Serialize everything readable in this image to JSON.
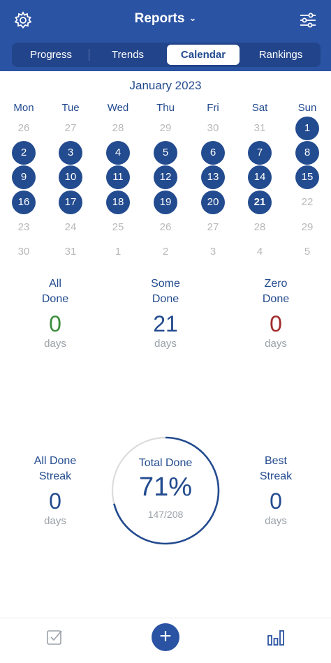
{
  "header": {
    "title": "Reports",
    "title_chevron": "⌄",
    "left_icon": "gear-icon",
    "right_icon": "sliders-icon"
  },
  "tabs": [
    {
      "label": "Progress",
      "active": false
    },
    {
      "label": "Trends",
      "active": false
    },
    {
      "label": "Calendar",
      "active": true
    },
    {
      "label": "Rankings",
      "active": false
    }
  ],
  "calendar": {
    "month_label": "January 2023",
    "weekdays": [
      "Mon",
      "Tue",
      "Wed",
      "Thu",
      "Fri",
      "Sat",
      "Sun"
    ],
    "weeks": [
      [
        {
          "d": "26",
          "s": "faded"
        },
        {
          "d": "27",
          "s": "faded"
        },
        {
          "d": "28",
          "s": "faded"
        },
        {
          "d": "29",
          "s": "faded"
        },
        {
          "d": "30",
          "s": "faded"
        },
        {
          "d": "31",
          "s": "faded"
        },
        {
          "d": "1",
          "s": "done"
        }
      ],
      [
        {
          "d": "2",
          "s": "done"
        },
        {
          "d": "3",
          "s": "done"
        },
        {
          "d": "4",
          "s": "done"
        },
        {
          "d": "5",
          "s": "done"
        },
        {
          "d": "6",
          "s": "done"
        },
        {
          "d": "7",
          "s": "done"
        },
        {
          "d": "8",
          "s": "done"
        }
      ],
      [
        {
          "d": "9",
          "s": "done"
        },
        {
          "d": "10",
          "s": "done"
        },
        {
          "d": "11",
          "s": "done"
        },
        {
          "d": "12",
          "s": "done"
        },
        {
          "d": "13",
          "s": "done"
        },
        {
          "d": "14",
          "s": "done"
        },
        {
          "d": "15",
          "s": "done"
        }
      ],
      [
        {
          "d": "16",
          "s": "done"
        },
        {
          "d": "17",
          "s": "done"
        },
        {
          "d": "18",
          "s": "done"
        },
        {
          "d": "19",
          "s": "done"
        },
        {
          "d": "20",
          "s": "done"
        },
        {
          "d": "21",
          "s": "done today"
        },
        {
          "d": "22",
          "s": "plain"
        }
      ],
      [
        {
          "d": "23",
          "s": "plain"
        },
        {
          "d": "24",
          "s": "plain"
        },
        {
          "d": "25",
          "s": "plain"
        },
        {
          "d": "26",
          "s": "plain"
        },
        {
          "d": "27",
          "s": "plain"
        },
        {
          "d": "28",
          "s": "plain"
        },
        {
          "d": "29",
          "s": "plain"
        }
      ],
      [
        {
          "d": "30",
          "s": "plain"
        },
        {
          "d": "31",
          "s": "plain"
        },
        {
          "d": "1",
          "s": "faded"
        },
        {
          "d": "2",
          "s": "faded"
        },
        {
          "d": "3",
          "s": "faded"
        },
        {
          "d": "4",
          "s": "faded"
        },
        {
          "d": "5",
          "s": "faded"
        }
      ]
    ]
  },
  "stats": {
    "all_done": {
      "line1": "All",
      "line2": "Done",
      "value": "0",
      "unit": "days",
      "color": "#3a8d3a"
    },
    "some_done": {
      "line1": "Some",
      "line2": "Done",
      "value": "21",
      "unit": "days",
      "color": "#234b8f"
    },
    "zero_done": {
      "line1": "Zero",
      "line2": "Done",
      "value": "0",
      "unit": "days",
      "color": "#a12a2a"
    }
  },
  "streaks": {
    "all_done_streak": {
      "line1": "All Done",
      "line2": "Streak",
      "value": "0",
      "unit": "days"
    },
    "best_streak": {
      "line1": "Best",
      "line2": "Streak",
      "value": "0",
      "unit": "days"
    }
  },
  "total": {
    "label": "Total Done",
    "percent": "71%",
    "fraction": "147/208",
    "progress": 0.71
  },
  "bottom_bar": {
    "left_icon": "checkbox-icon",
    "center_icon": "plus-icon",
    "center_label": "+",
    "right_icon": "bar-chart-icon"
  },
  "colors": {
    "header": "#2b53a3",
    "accent": "#234b8f",
    "ring_track": "#dcdcdc"
  }
}
